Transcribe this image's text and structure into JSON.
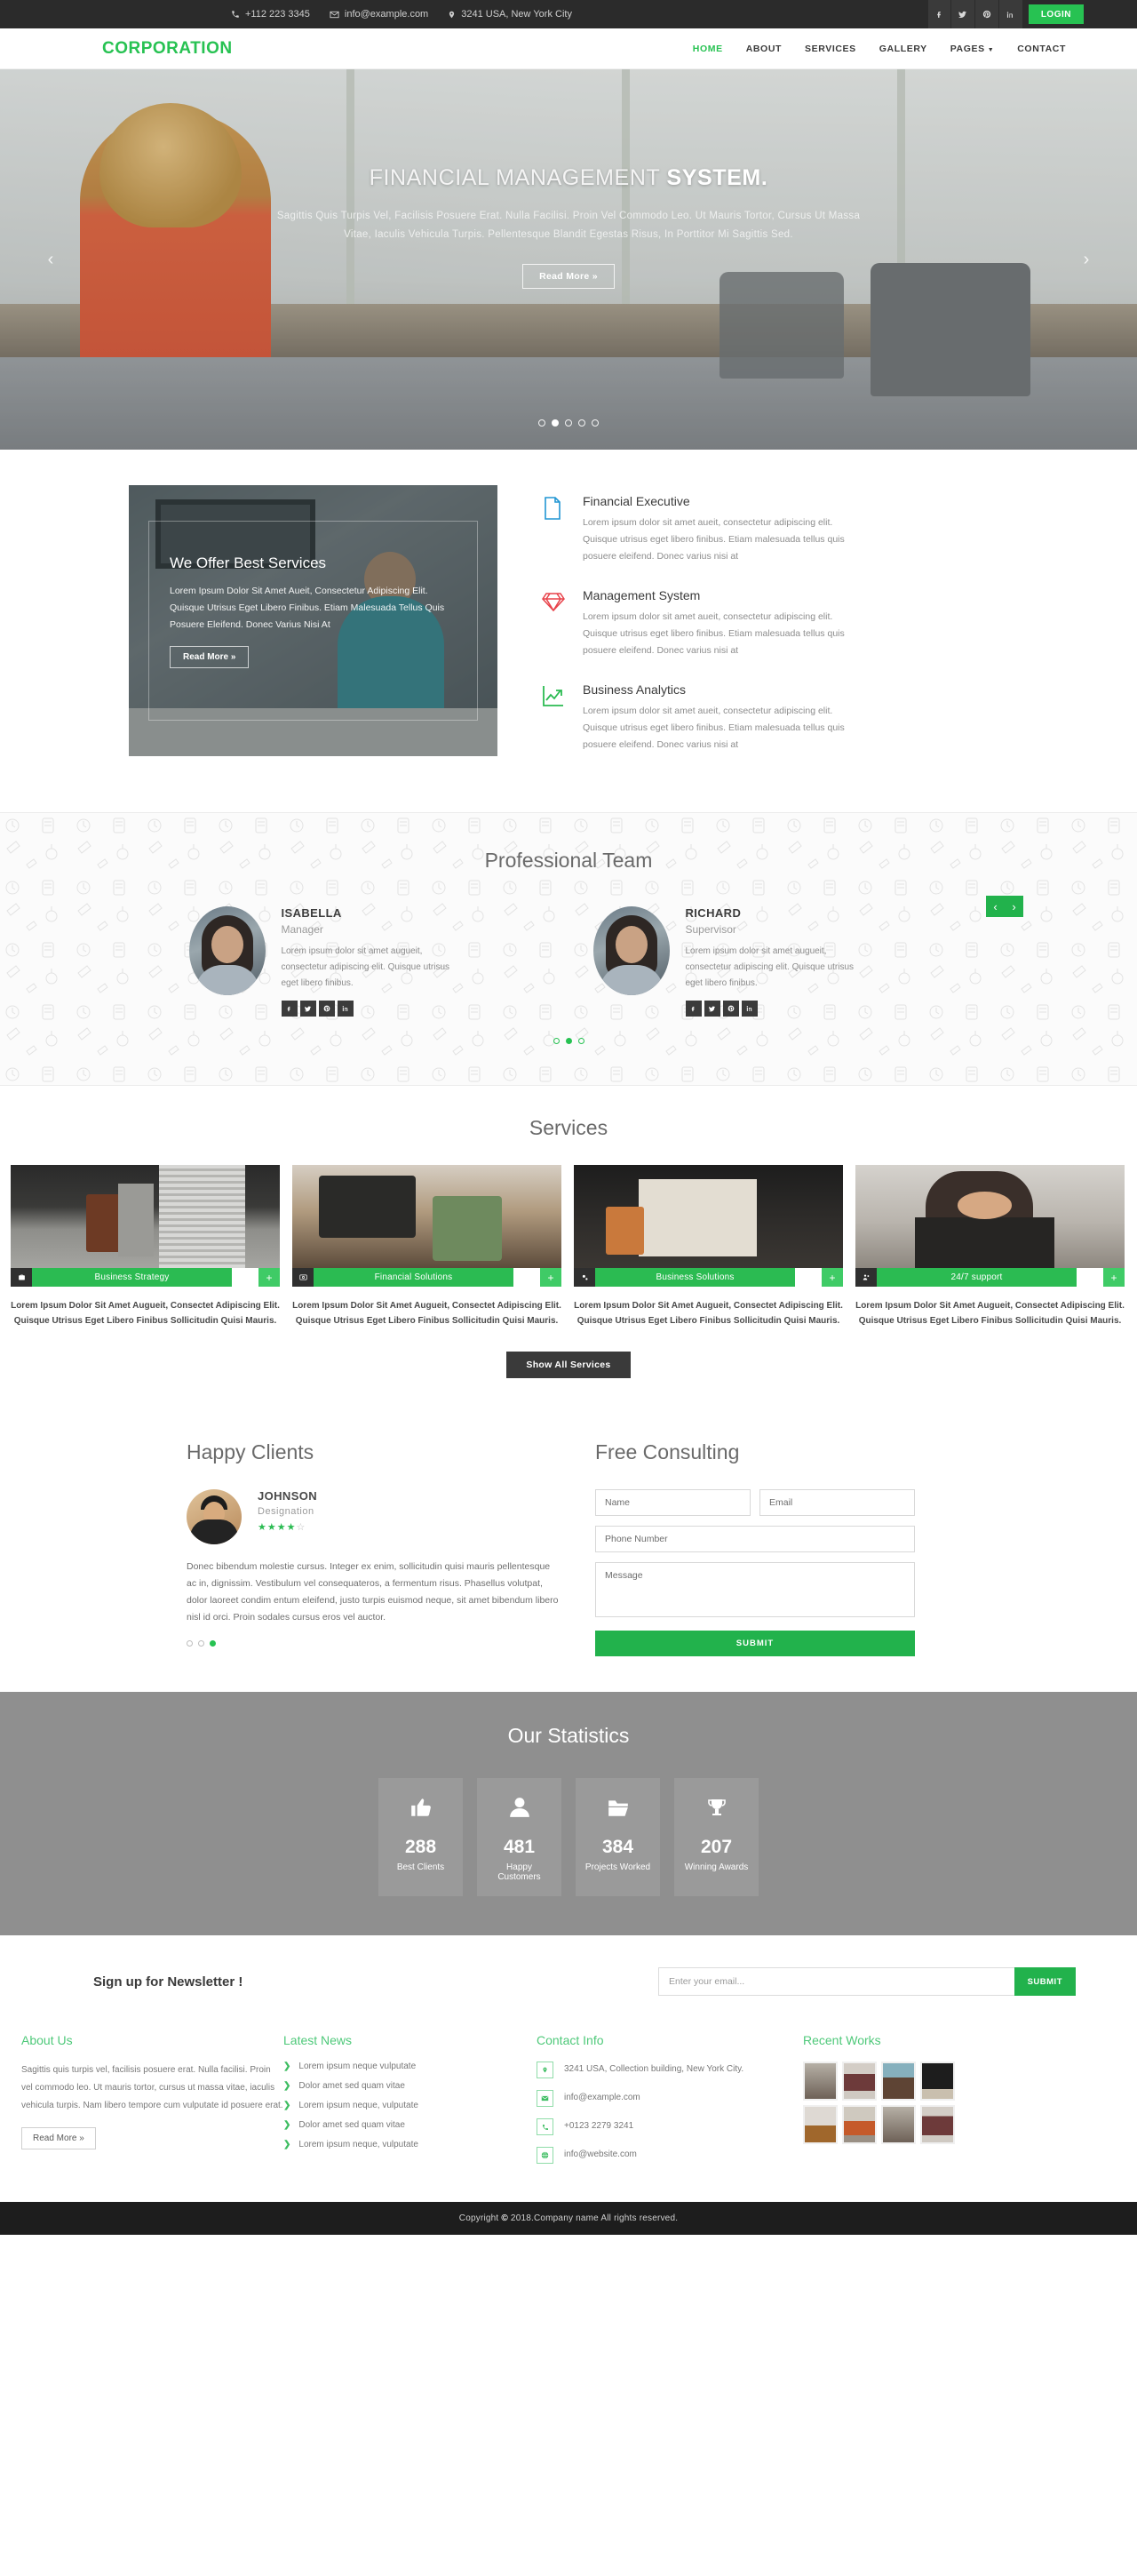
{
  "colors": {
    "brand": "#27c252",
    "brand_dark": "#22b24c",
    "dark": "#2b2b2b",
    "stats_bg": "#8f8f8f"
  },
  "topbar": {
    "phone": "+112 223 3345",
    "email": "info@example.com",
    "address": "3241 USA, New York City",
    "socials": [
      "facebook-icon",
      "twitter-icon",
      "pinterest-icon",
      "linkedin-icon"
    ],
    "login_label": "LOGIN"
  },
  "nav": {
    "logo": "CORPORATION",
    "items": [
      {
        "label": "HOME",
        "active": true
      },
      {
        "label": "ABOUT",
        "active": false
      },
      {
        "label": "SERVICES",
        "active": false
      },
      {
        "label": "GALLERY",
        "active": false
      },
      {
        "label": "PAGES",
        "active": false,
        "caret": true
      },
      {
        "label": "CONTACT",
        "active": false
      }
    ]
  },
  "hero": {
    "title_light": "FINANCIAL MANAGEMENT ",
    "title_bold": "SYSTEM.",
    "subtitle": "Sagittis Quis Turpis Vel, Facilisis Posuere Erat. Nulla Facilisi. Proin Vel Commodo Leo. Ut Mauris Tortor, Cursus Ut Massa Vitae, Iaculis Vehicula Turpis. Pellentesque Blandit Egestas Risus, In Porttitor Mi Sagittis Sed.",
    "button": "Read More »",
    "prev": "‹",
    "next": "›",
    "dots": 5,
    "active_dot": 1
  },
  "offer": {
    "title": "We Offer Best Services",
    "text": "Lorem Ipsum Dolor Sit Amet Aueit, Consectetur Adipiscing Elit. Quisque Utrisus Eget Libero Finibus. Etiam Malesuada Tellus Quis Posuere Eleifend. Donec Varius Nisi At",
    "button": "Read More »",
    "features": [
      {
        "icon": "document-icon",
        "color": "#2196d3",
        "title": "Financial Executive",
        "text": "Lorem ipsum dolor sit amet aueit, consectetur adipiscing elit. Quisque utrisus eget libero finibus. Etiam malesuada tellus quis posuere eleifend. Donec varius nisi at"
      },
      {
        "icon": "diamond-icon",
        "color": "#e8424a",
        "title": "Management System",
        "text": "Lorem ipsum dolor sit amet aueit, consectetur adipiscing elit. Quisque utrisus eget libero finibus. Etiam malesuada tellus quis posuere eleifend. Donec varius nisi at"
      },
      {
        "icon": "growth-chart-icon",
        "color": "#2bbb52",
        "title": "Business Analytics",
        "text": "Lorem ipsum dolor sit amet aueit, consectetur adipiscing elit. Quisque utrisus eget libero finibus. Etiam malesuada tellus quis posuere eleifend. Donec varius nisi at"
      }
    ]
  },
  "team": {
    "title": "Professional Team",
    "prev": "‹",
    "next": "›",
    "members": [
      {
        "name": "ISABELLA",
        "role": "Manager",
        "text": "Lorem ipsum dolor sit amet augueit, consectetur adipiscing elit. Quisque utrisus eget libero finibus.",
        "socials": [
          "facebook-icon",
          "twitter-icon",
          "pinterest-icon",
          "linkedin-icon"
        ]
      },
      {
        "name": "RICHARD",
        "role": "Supervisor",
        "text": "Lorem ipsum dolor sit amet augueit, consectetur adipiscing elit. Quisque utrisus eget libero finibus.",
        "socials": [
          "facebook-icon",
          "twitter-icon",
          "pinterest-icon",
          "linkedin-icon"
        ]
      }
    ],
    "dots": 3,
    "active_dot": 1
  },
  "services": {
    "title": "Services",
    "show_all": "Show All Services",
    "items": [
      {
        "icon": "briefcase-icon",
        "label": "Business Strategy",
        "plus": "+",
        "text": "Lorem Ipsum Dolor Sit Amet Augueit, Consectet Adipiscing Elit. Quisque Utrisus Eget Libero Finibus Sollicitudin Quisi Mauris."
      },
      {
        "icon": "coin-icon",
        "label": "Financial Solutions",
        "plus": "+",
        "text": "Lorem Ipsum Dolor Sit Amet Augueit, Consectet Adipiscing Elit. Quisque Utrisus Eget Libero Finibus Sollicitudin Quisi Mauris."
      },
      {
        "icon": "gears-icon",
        "label": "Business Solutions",
        "plus": "+",
        "text": "Lorem Ipsum Dolor Sit Amet Augueit, Consectet Adipiscing Elit. Quisque Utrisus Eget Libero Finibus Sollicitudin Quisi Mauris."
      },
      {
        "icon": "support-icon",
        "label": "24/7 support",
        "plus": "+",
        "text": "Lorem Ipsum Dolor Sit Amet Augueit, Consectet Adipiscing Elit. Quisque Utrisus Eget Libero Finibus Sollicitudin Quisi Mauris."
      }
    ]
  },
  "clients": {
    "title": "Happy Clients",
    "name": "JOHNSON",
    "designation": "Designation",
    "rating": 4,
    "rating_max": 5,
    "quote": "Donec bibendum molestie cursus. Integer ex enim, sollicitudin quisi mauris pellentesque ac in, dignissim. Vestibulum vel consequateros, a fermentum risus. Phasellus volutpat, dolor laoreet condim entum eleifend, justo turpis euismod neque, sit amet bibendum libero nisl id orci. Proin sodales cursus eros vel auctor.",
    "dots": 3,
    "active_dot": 2
  },
  "consult": {
    "title": "Free Consulting",
    "name_placeholder": "Name",
    "email_placeholder": "Email",
    "phone_placeholder": "Phone Number",
    "message_placeholder": "Message",
    "submit": "SUBMIT"
  },
  "stats": {
    "title": "Our Statistics",
    "items": [
      {
        "icon": "thumbs-up-icon",
        "number": "288",
        "label": "Best Clients"
      },
      {
        "icon": "user-icon",
        "number": "481",
        "label": "Happy Customers"
      },
      {
        "icon": "folder-icon",
        "number": "384",
        "label": "Projects Worked"
      },
      {
        "icon": "trophy-icon",
        "number": "207",
        "label": "Winning Awards"
      }
    ]
  },
  "newsletter": {
    "title": "Sign up for Newsletter !",
    "placeholder": "Enter your email...",
    "submit": "SUBMIT"
  },
  "footer": {
    "about": {
      "title": "About Us",
      "text": "Sagittis quis turpis vel, facilisis posuere erat. Nulla facilisi. Proin vel commodo leo. Ut mauris tortor, cursus ut massa vitae, iaculis vehicula turpis. Nam libero tempore cum vulputate id posuere erat.",
      "button": "Read More »"
    },
    "news": {
      "title": "Latest News",
      "items": [
        "Lorem ipsum neque vulputate",
        "Dolor amet sed quam vitae",
        "Lorem ipsum neque, vulputate",
        "Dolor amet sed quam vitae",
        "Lorem ipsum neque, vulputate"
      ]
    },
    "contact": {
      "title": "Contact Info",
      "items": [
        {
          "icon": "map-pin-icon",
          "text": "3241 USA, Collection building, New York City."
        },
        {
          "icon": "envelope-icon",
          "text": "info@example.com"
        },
        {
          "icon": "phone-icon",
          "text": "+0123 2279 3241"
        },
        {
          "icon": "globe-icon",
          "text": "info@website.com"
        }
      ]
    },
    "works": {
      "title": "Recent Works",
      "count": 8
    },
    "copyright_prefix": "Copyright ",
    "copyright_symbol": "©",
    "copyright_text": " 2018.Company name All rights reserved."
  }
}
